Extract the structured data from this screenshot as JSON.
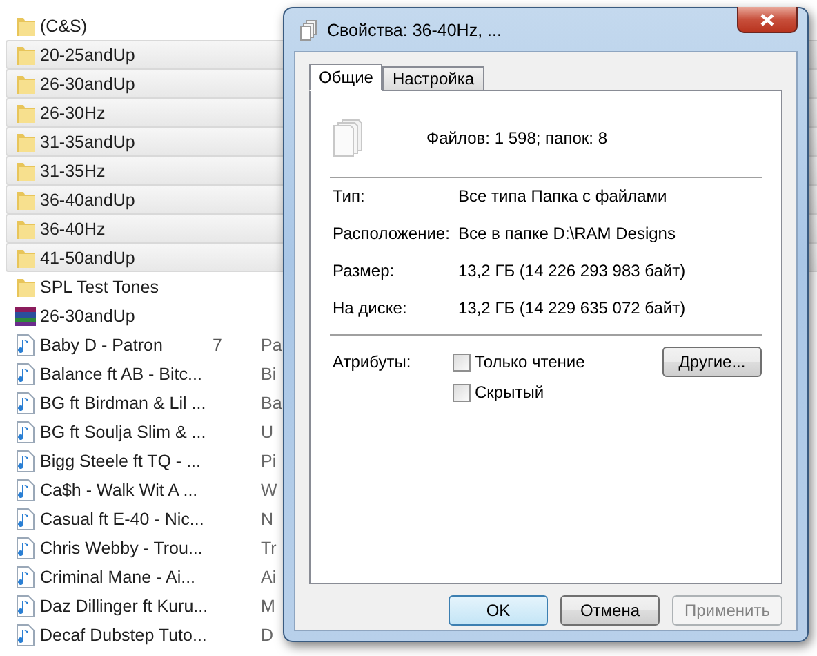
{
  "explorer": {
    "rows": [
      {
        "kind": "folder",
        "name": "(C&S)",
        "selected": false
      },
      {
        "kind": "folder",
        "name": "20-25andUp",
        "selected": true
      },
      {
        "kind": "folder",
        "name": "26-30andUp",
        "selected": true
      },
      {
        "kind": "folder",
        "name": "26-30Hz",
        "selected": true
      },
      {
        "kind": "folder",
        "name": "31-35andUp",
        "selected": true
      },
      {
        "kind": "folder",
        "name": "31-35Hz",
        "selected": true
      },
      {
        "kind": "folder",
        "name": "36-40andUp",
        "selected": true
      },
      {
        "kind": "folder",
        "name": "36-40Hz",
        "selected": true
      },
      {
        "kind": "folder",
        "name": "41-50andUp",
        "selected": true
      },
      {
        "kind": "folder",
        "name": "SPL Test Tones",
        "selected": false
      },
      {
        "kind": "archive",
        "name": "26-30andUp",
        "selected": false
      },
      {
        "kind": "audio",
        "name": "Baby D - Patron",
        "selected": false,
        "column_2": "7",
        "column_3": "Pa"
      },
      {
        "kind": "audio",
        "name": "Balance ft AB - Bitc...",
        "selected": false,
        "column_3": "Bi"
      },
      {
        "kind": "audio",
        "name": "BG ft Birdman & Lil ...",
        "selected": false,
        "column_3": "Ba"
      },
      {
        "kind": "audio",
        "name": "BG ft Soulja Slim & ...",
        "selected": false,
        "column_3": "U"
      },
      {
        "kind": "audio",
        "name": "Bigg Steele ft TQ - ...",
        "selected": false,
        "column_3": "Pi"
      },
      {
        "kind": "audio",
        "name": "Ca$h - Walk Wit A ...",
        "selected": false,
        "column_3": "W"
      },
      {
        "kind": "audio",
        "name": "Casual ft E-40 - Nic...",
        "selected": false,
        "column_3": "N"
      },
      {
        "kind": "audio",
        "name": "Chris Webby - Trou...",
        "selected": false,
        "column_3": "Tr"
      },
      {
        "kind": "audio",
        "name": "Criminal Mane - Ai...",
        "selected": false,
        "column_3": "Ai"
      },
      {
        "kind": "audio",
        "name": "Daz Dillinger ft Kuru...",
        "selected": false,
        "column_3": "M"
      },
      {
        "kind": "audio",
        "name": "Decaf Dubstep Tuto...",
        "selected": false,
        "column_3": "D"
      }
    ]
  },
  "dialog": {
    "title": "Свойства: 36-40Hz, ...",
    "tabs": [
      {
        "label": "Общие",
        "selected": true
      },
      {
        "label": "Настройка",
        "selected": false
      }
    ],
    "summary": "Файлов: 1 598; папок: 8",
    "properties": [
      {
        "label": "Тип:",
        "value": "Все типа Папка с файлами"
      },
      {
        "label": "Расположение:",
        "value": "Все в папке D:\\RAM Designs"
      },
      {
        "label": "Размер:",
        "value": "13,2 ГБ (14 226 293 983 байт)"
      },
      {
        "label": "На диске:",
        "value": "13,2 ГБ (14 229 635 072 байт)"
      }
    ],
    "attributes_label": "Атрибуты:",
    "attributes": [
      {
        "label": "Только чтение",
        "checked": false
      },
      {
        "label": "Скрытый",
        "checked": false
      }
    ],
    "other_button": "Другие...",
    "buttons": [
      {
        "label": "OK",
        "kind": "default",
        "disabled": false
      },
      {
        "label": "Отмена",
        "kind": "normal",
        "disabled": false
      },
      {
        "label": "Применить",
        "kind": "normal",
        "disabled": true
      }
    ]
  }
}
